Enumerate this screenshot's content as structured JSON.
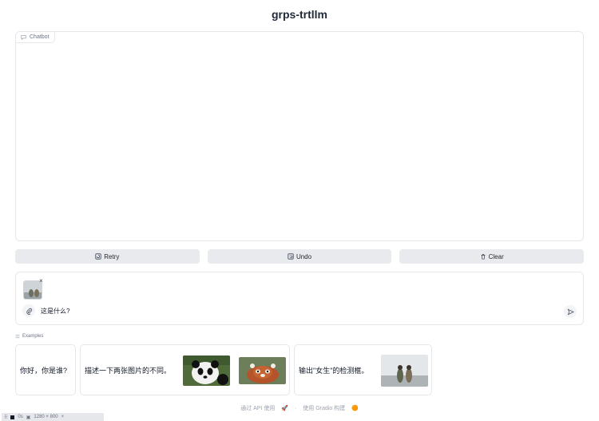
{
  "app": {
    "title": "grps-trtllm"
  },
  "chatbot": {
    "label": "Chatbot"
  },
  "buttons": {
    "retry": "Retry",
    "undo": "Undo",
    "clear": "Clear"
  },
  "input": {
    "value": "这是什么?",
    "thumb_close": "×"
  },
  "examples": {
    "label": "Examples",
    "items": [
      {
        "text": "你好，你是谁?"
      },
      {
        "text": "描述一下两张图片的不同。"
      },
      {
        "text": "输出\"女生\"的检测框。"
      }
    ]
  },
  "footer": {
    "api": "通过 API 使用",
    "sep": "·",
    "built": "使用 Gradio 构建"
  },
  "devbar": {
    "time": "0s",
    "size": "1280 × 800",
    "close": "×"
  }
}
